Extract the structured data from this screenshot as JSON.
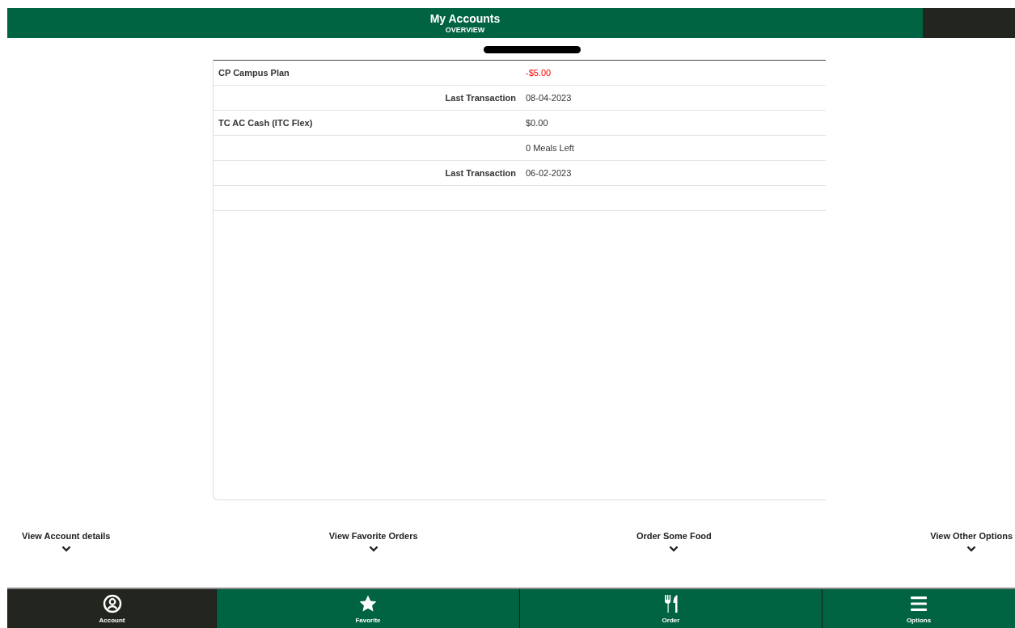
{
  "header": {
    "title": "My Accounts",
    "subtitle": "OVERVIEW"
  },
  "accounts": [
    {
      "kind": "account",
      "label": "CP Campus Plan",
      "value": "-$5.00",
      "negative": true
    },
    {
      "kind": "detail",
      "label": "Last Transaction",
      "value": "08-04-2023",
      "negative": false
    },
    {
      "kind": "account",
      "label": "TC AC Cash (ITC Flex)",
      "value": "$0.00",
      "negative": false
    },
    {
      "kind": "detail",
      "value": "0 Meals Left",
      "negative": false
    },
    {
      "kind": "detail",
      "label": "Last Transaction",
      "value": "06-02-2023",
      "negative": false
    },
    {
      "kind": "blank"
    }
  ],
  "hints": [
    "View Account details",
    "View Favorite Orders",
    "Order Some Food",
    "View Other Options"
  ],
  "nav": [
    {
      "label": "Account",
      "kind": "user",
      "selected": true
    },
    {
      "label": "Favorite",
      "kind": "star",
      "selected": false
    },
    {
      "label": "Order",
      "kind": "fork",
      "selected": false
    },
    {
      "label": "Options",
      "kind": "menu",
      "selected": false
    }
  ]
}
